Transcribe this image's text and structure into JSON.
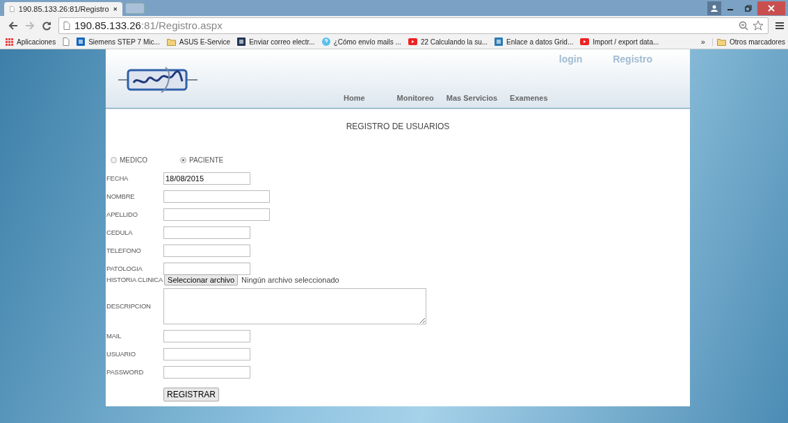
{
  "browser": {
    "tab": {
      "title": "190.85.133.26:81/Registro"
    },
    "address": {
      "host": "190.85.133.26",
      "rest": ":81/Registro.aspx"
    },
    "bookmarks": [
      {
        "label": "Aplicaciones"
      },
      {
        "label": "Siemens STEP 7 Mic..."
      },
      {
        "label": "ASUS E-Service"
      },
      {
        "label": "Enviar correo electr..."
      },
      {
        "label": "¿Cómo envío mails ..."
      },
      {
        "label": "22 Calculando la su..."
      },
      {
        "label": "Enlace a datos Grid..."
      },
      {
        "label": "Import / export data..."
      }
    ],
    "more": "»",
    "other": "Otros marcadores"
  },
  "nav": {
    "top": [
      "login",
      "Registro"
    ],
    "menu": [
      "Home",
      "Monitoreo",
      "Mas Servicios",
      "Examenes"
    ]
  },
  "title": "REGISTRO DE USUARIOS",
  "roles": [
    {
      "label": "MEDICO",
      "selected": false
    },
    {
      "label": "PACIENTE",
      "selected": true
    }
  ],
  "fields": [
    {
      "label": "FECHA",
      "kind": "text",
      "value": "18/08/2015"
    },
    {
      "label": "NOMBRE",
      "kind": "wide"
    },
    {
      "label": "APELLIDO",
      "kind": "wide"
    },
    {
      "label": "CEDULA",
      "kind": "text"
    },
    {
      "label": "TELEFONO",
      "kind": "text"
    },
    {
      "label": "PATOLOGIA",
      "kind": "text"
    },
    {
      "label": "HISTORIA CLINICA",
      "kind": "file",
      "button": "Seleccionar archivo",
      "status": "Ningún archivo seleccionado"
    },
    {
      "label": "DESCRIPCION",
      "kind": "textarea"
    },
    {
      "label": "MAIL",
      "kind": "text"
    },
    {
      "label": "USUARIO",
      "kind": "text"
    },
    {
      "label": "PASSWORD",
      "kind": "text"
    }
  ],
  "submit": "REGISTRAR"
}
